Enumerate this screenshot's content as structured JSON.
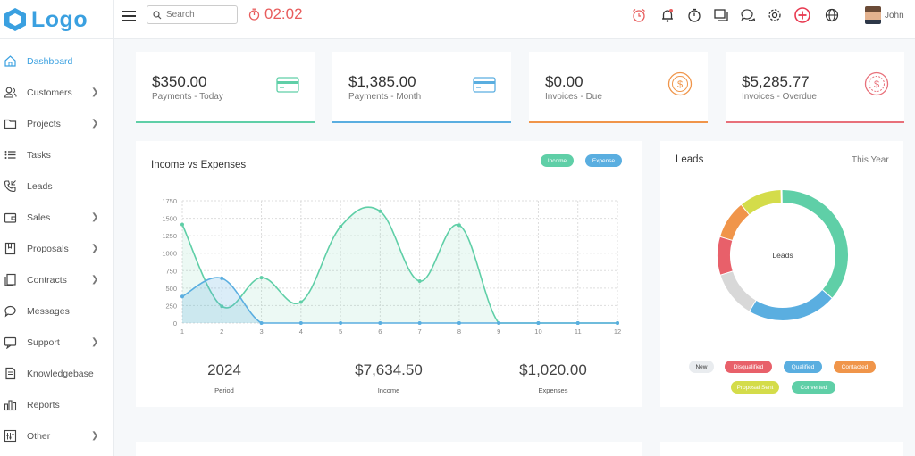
{
  "brand": {
    "logo_text": "Logo"
  },
  "search": {
    "placeholder": "Search"
  },
  "timer": {
    "value": "02:02"
  },
  "header_icons": [
    "alarm-clock-icon",
    "bell-icon",
    "stopwatch-icon",
    "windows-icon",
    "chat-icon",
    "gear-icon",
    "add-circle-icon",
    "globe-icon"
  ],
  "user": {
    "name": "John"
  },
  "sidebar": {
    "items": [
      {
        "label": "Dashboard",
        "icon": "home-icon",
        "has_children": false,
        "active": true
      },
      {
        "label": "Customers",
        "icon": "users-icon",
        "has_children": true
      },
      {
        "label": "Projects",
        "icon": "folder-icon",
        "has_children": true
      },
      {
        "label": "Tasks",
        "icon": "list-icon",
        "has_children": false
      },
      {
        "label": "Leads",
        "icon": "phone-icon",
        "has_children": false
      },
      {
        "label": "Sales",
        "icon": "wallet-icon",
        "has_children": true
      },
      {
        "label": "Proposals",
        "icon": "bookmark-icon",
        "has_children": true
      },
      {
        "label": "Contracts",
        "icon": "documents-icon",
        "has_children": true
      },
      {
        "label": "Messages",
        "icon": "message-icon",
        "has_children": false
      },
      {
        "label": "Support",
        "icon": "support-icon",
        "has_children": true
      },
      {
        "label": "Knowledgebase",
        "icon": "book-icon",
        "has_children": false
      },
      {
        "label": "Reports",
        "icon": "bar-chart-icon",
        "has_children": false
      },
      {
        "label": "Other",
        "icon": "sliders-icon",
        "has_children": true
      }
    ]
  },
  "stats": [
    {
      "value": "$350.00",
      "label": "Payments - Today",
      "color": "#5fcfa7",
      "icon": "credit-card-icon"
    },
    {
      "value": "$1,385.00",
      "label": "Payments - Month",
      "color": "#5aaee0",
      "icon": "credit-card-icon"
    },
    {
      "value": "$0.00",
      "label": "Invoices - Due",
      "color": "#f0954a",
      "icon": "dollar-coin-icon"
    },
    {
      "value": "$5,285.77",
      "label": "Invoices - Overdue",
      "color": "#e8707a",
      "icon": "dollar-coin-icon"
    }
  ],
  "income_chart": {
    "title": "Income vs Expenses",
    "legend": [
      {
        "label": "Income",
        "color": "#5fcfa7"
      },
      {
        "label": "Expense",
        "color": "#5aaee0"
      }
    ],
    "summary": [
      {
        "value": "2024",
        "label": "Period"
      },
      {
        "value": "$7,634.50",
        "label": "Income"
      },
      {
        "value": "$1,020.00",
        "label": "Expenses"
      }
    ]
  },
  "leads_card": {
    "title": "Leads",
    "period": "This Year",
    "center_label": "Leads",
    "legend": [
      {
        "label": "New",
        "color": "#e9ecef",
        "text_color": "#333"
      },
      {
        "label": "Disqualified",
        "color": "#e8606a",
        "text_color": "#fff"
      },
      {
        "label": "Qualified",
        "color": "#5aaee0",
        "text_color": "#fff"
      },
      {
        "label": "Contacted",
        "color": "#f0954a",
        "text_color": "#fff"
      },
      {
        "label": "Proposal Sent",
        "color": "#d4dc4a",
        "text_color": "#fff"
      },
      {
        "label": "Converted",
        "color": "#5fcfa7",
        "text_color": "#fff"
      }
    ]
  },
  "chart_data": [
    {
      "type": "area",
      "title": "Income vs Expenses",
      "x": [
        1,
        2,
        3,
        4,
        5,
        6,
        7,
        8,
        9,
        10,
        11,
        12
      ],
      "xlim": [
        1,
        12
      ],
      "ylim": [
        0,
        1750
      ],
      "yticks": [
        0,
        250,
        500,
        750,
        1000,
        1250,
        1500,
        1750
      ],
      "grid": true,
      "legend_position": "top-right",
      "series": [
        {
          "name": "Income",
          "color": "#5fcfa7",
          "values": [
            1410,
            240,
            650,
            300,
            1380,
            1600,
            600,
            1400,
            0,
            0,
            0,
            0
          ]
        },
        {
          "name": "Expense",
          "color": "#5aaee0",
          "values": [
            380,
            640,
            0,
            0,
            0,
            0,
            0,
            0,
            0,
            0,
            0,
            0
          ]
        }
      ]
    },
    {
      "type": "pie",
      "title": "Leads",
      "categories": [
        "Converted",
        "Qualified",
        "New",
        "Disqualified",
        "Contacted",
        "Proposal Sent"
      ],
      "values": [
        35,
        21,
        11,
        9,
        9,
        10
      ],
      "colors": [
        "#5fcfa7",
        "#5aaee0",
        "#d8d8d8",
        "#e8606a",
        "#f0954a",
        "#d4dc4a"
      ],
      "legend_position": "bottom"
    }
  ]
}
